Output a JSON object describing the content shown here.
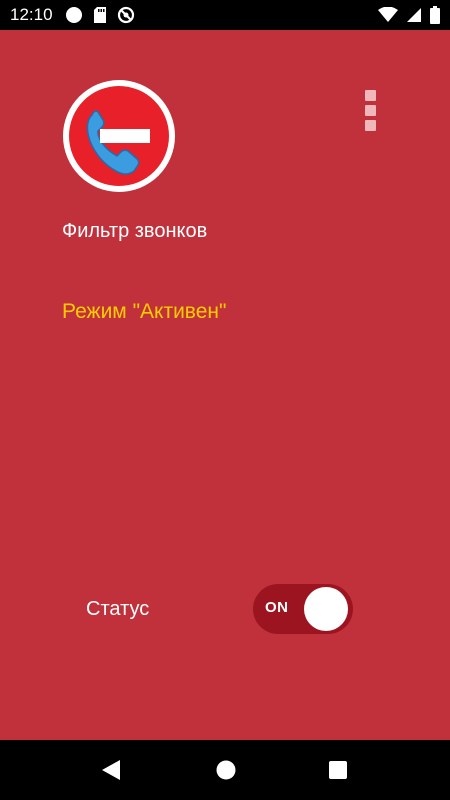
{
  "status_bar": {
    "time": "12:10",
    "icons_left": [
      "circle-notification-icon",
      "sd-card-icon",
      "no-sync-icon"
    ],
    "icons_right": [
      "wifi-icon",
      "signal-icon",
      "battery-icon"
    ]
  },
  "app": {
    "title": "Фильтр звонков",
    "mode": "Режим \"Активен\"",
    "status_label": "Статус",
    "toggle_text": "ON",
    "toggle_on": true
  },
  "colors": {
    "background": "#c0313b",
    "accent_text": "#ffcc00",
    "toggle_track": "#9c1420",
    "logo_red": "#e8202a",
    "phone_blue": "#3b9de0"
  },
  "nav_bar": {
    "icons": [
      "back-icon",
      "home-icon",
      "recents-icon"
    ]
  }
}
